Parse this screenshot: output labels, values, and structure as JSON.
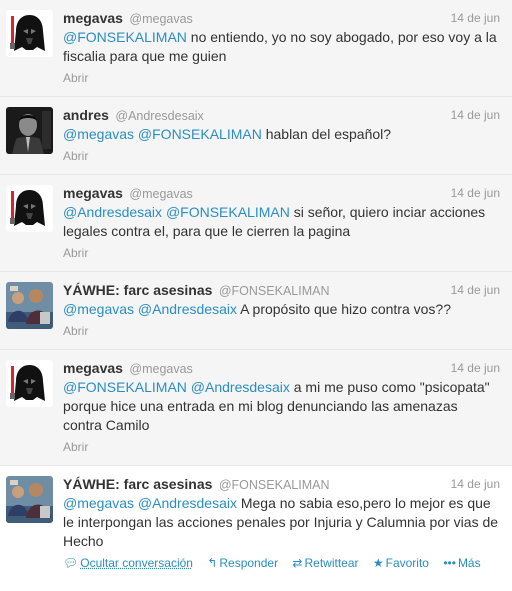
{
  "tweets": [
    {
      "fullname": "megavas",
      "username": "@megavas",
      "date": "14 de jun",
      "avatar": "darth-vader-avatar",
      "parts": [
        {
          "t": "@FONSEKALIMAN",
          "m": true
        },
        {
          "t": " no entiendo, yo no soy abogado, por eso voy a la fiscalia para que me guien",
          "m": false
        }
      ],
      "expand": "Abrir"
    },
    {
      "fullname": "andres",
      "username": "@Andresdesaix",
      "date": "14 de jun",
      "avatar": "andres-photo-avatar",
      "parts": [
        {
          "t": "@megavas",
          "m": true
        },
        {
          "t": " ",
          "m": false
        },
        {
          "t": "@FONSEKALIMAN",
          "m": true
        },
        {
          "t": " hablan del español?",
          "m": false
        }
      ],
      "expand": "Abrir"
    },
    {
      "fullname": "megavas",
      "username": "@megavas",
      "date": "14 de jun",
      "avatar": "darth-vader-avatar",
      "parts": [
        {
          "t": "@Andresdesaix",
          "m": true
        },
        {
          "t": " ",
          "m": false
        },
        {
          "t": "@FONSEKALIMAN",
          "m": true
        },
        {
          "t": " si señor, quiero inciar acciones legales contra el, para que le cierren la pagina",
          "m": false
        }
      ],
      "expand": "Abrir"
    },
    {
      "fullname": "YÁWHE: farc asesinas",
      "username": "@FONSEKALIMAN",
      "date": "14 de jun",
      "avatar": "group-photo-avatar",
      "parts": [
        {
          "t": "@megavas",
          "m": true
        },
        {
          "t": " ",
          "m": false
        },
        {
          "t": "@Andresdesaix",
          "m": true
        },
        {
          "t": " A propósito que hizo contra vos??",
          "m": false
        }
      ],
      "expand": "Abrir"
    },
    {
      "fullname": "megavas",
      "username": "@megavas",
      "date": "14 de jun",
      "avatar": "darth-vader-avatar",
      "parts": [
        {
          "t": "@FONSEKALIMAN",
          "m": true
        },
        {
          "t": " ",
          "m": false
        },
        {
          "t": "@Andresdesaix",
          "m": true
        },
        {
          "t": " a mi me puso como \"psicopata\" porque hice una entrada en mi blog denunciando las amenazas contra Camilo",
          "m": false
        }
      ],
      "expand": "Abrir"
    },
    {
      "fullname": "YÁWHE: farc asesinas",
      "username": "@FONSEKALIMAN",
      "date": "14 de jun",
      "avatar": "group-photo-avatar",
      "parts": [
        {
          "t": "@megavas",
          "m": true
        },
        {
          "t": " ",
          "m": false
        },
        {
          "t": "@Andresdesaix",
          "m": true
        },
        {
          "t": " Mega no sabia eso,pero lo mejor es que le interpongan las acciones penales por Injuria y Calumnia por vias de Hecho",
          "m": false
        }
      ],
      "expand": null
    }
  ],
  "actions": {
    "hide": {
      "icon": "speech-bubble-icon",
      "label": "Ocultar conversación"
    },
    "reply": {
      "icon": "reply-arrow-icon",
      "label": "Responder"
    },
    "retweet": {
      "icon": "retweet-icon",
      "label": "Retwittear"
    },
    "favorite": {
      "icon": "star-icon",
      "label": "Favorito"
    },
    "more": {
      "icon": "ellipsis-icon",
      "label": "Más"
    }
  },
  "colors": {
    "link": "#2a8ec2",
    "muted": "#999999",
    "text": "#333333",
    "collapsed_bg": "#f5f5f5"
  }
}
